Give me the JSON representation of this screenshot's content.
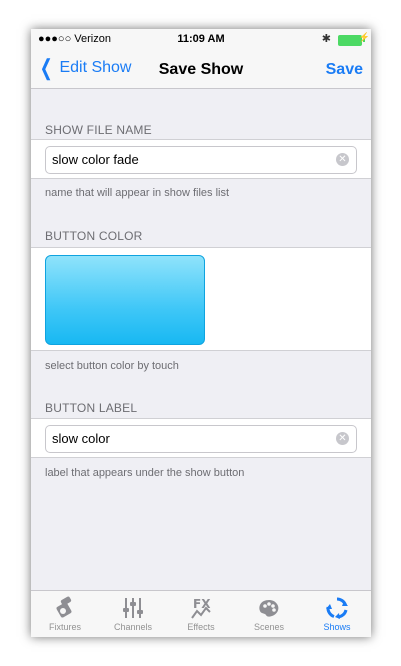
{
  "status_bar": {
    "carrier": "●●●○○ Verizon",
    "time": "11:09 AM"
  },
  "nav": {
    "back_label": "Edit Show",
    "title": "Save Show",
    "save_label": "Save"
  },
  "show_file": {
    "header": "SHOW FILE NAME",
    "value": "slow color fade",
    "footer": "name that will appear in show files list"
  },
  "button_color": {
    "header": "BUTTON COLOR",
    "color": "#2ec0f5",
    "footer": "select button color by touch"
  },
  "button_label": {
    "header": "BUTTON LABEL",
    "value": "slow color",
    "footer": "label that appears under the show button"
  },
  "tabs": [
    {
      "label": "Fixtures",
      "icon": "fixtures-icon",
      "active": false
    },
    {
      "label": "Channels",
      "icon": "channels-icon",
      "active": false
    },
    {
      "label": "Effects",
      "icon": "effects-icon",
      "active": false
    },
    {
      "label": "Scenes",
      "icon": "scenes-icon",
      "active": false
    },
    {
      "label": "Shows",
      "icon": "shows-icon",
      "active": true
    }
  ],
  "colors": {
    "accent": "#1a7cf5",
    "inactive": "#929292",
    "background": "#efeff4"
  }
}
